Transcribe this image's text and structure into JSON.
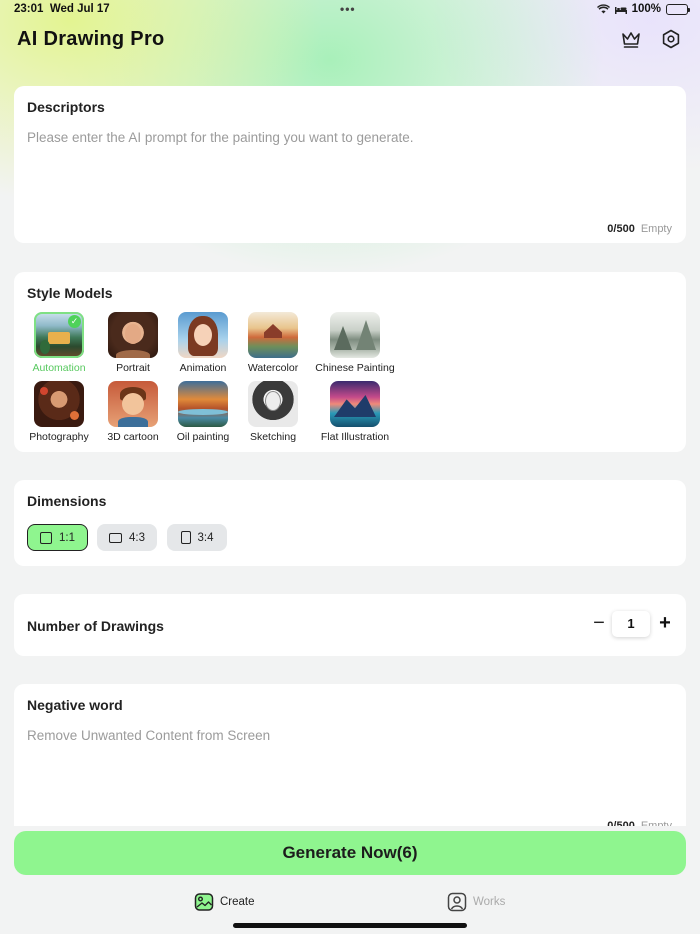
{
  "status_bar": {
    "time": "23:01",
    "date": "Wed Jul 17",
    "dots": "•••",
    "battery_percent": "100%"
  },
  "header": {
    "title": "AI Drawing Pro",
    "crown_icon": "crown-icon",
    "settings_icon": "settings-icon"
  },
  "descriptors": {
    "title": "Descriptors",
    "placeholder": "Please enter the AI prompt for the painting you want to generate.",
    "value": "",
    "count": "0/500",
    "state": "Empty"
  },
  "style_models": {
    "title": "Style Models",
    "selected": "Automation",
    "items": [
      {
        "label": "Automation"
      },
      {
        "label": "Portrait"
      },
      {
        "label": "Animation"
      },
      {
        "label": "Watercolor"
      },
      {
        "label": "Chinese Painting"
      },
      {
        "label": "Photography"
      },
      {
        "label": "3D cartoon"
      },
      {
        "label": "Oil painting"
      },
      {
        "label": "Sketching"
      },
      {
        "label": "Flat Illustration"
      }
    ]
  },
  "dimensions": {
    "title": "Dimensions",
    "selected": "1:1",
    "options": [
      {
        "label": "1:1"
      },
      {
        "label": "4:3"
      },
      {
        "label": "3:4"
      }
    ]
  },
  "number_of_drawings": {
    "title": "Number of Drawings",
    "minus": "−",
    "value": "1",
    "plus": "+"
  },
  "negative_word": {
    "title": "Negative word",
    "placeholder": "Remove Unwanted Content from Screen",
    "value": "",
    "count": "0/500",
    "state": "Empty"
  },
  "generate_button": {
    "label": "Generate Now(6)"
  },
  "tabs": {
    "create": "Create",
    "works": "Works"
  },
  "colors": {
    "accent_green": "#8ff58f",
    "selected_text": "#57c95f",
    "card_bg": "#ffffff",
    "page_bg": "#f2f3f3"
  }
}
